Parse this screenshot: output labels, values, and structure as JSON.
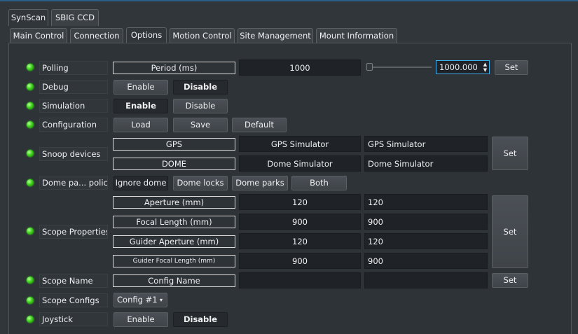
{
  "top_tabs": [
    "SynScan",
    "SBIG CCD"
  ],
  "sub_tabs": [
    "Main Control",
    "Connection",
    "Options",
    "Motion Control",
    "Site Management",
    "Mount Information"
  ],
  "polling": {
    "label": "Polling",
    "header": "Period (ms)",
    "value": "1000",
    "spin_value": "1000.000",
    "set": "Set"
  },
  "debug": {
    "label": "Debug",
    "enable": "Enable",
    "disable": "Disable"
  },
  "simulation": {
    "label": "Simulation",
    "enable": "Enable",
    "disable": "Disable"
  },
  "configuration": {
    "label": "Configuration",
    "load": "Load",
    "save": "Save",
    "default": "Default"
  },
  "snoop": {
    "label": "Snoop devices",
    "rows": [
      {
        "header": "GPS",
        "value": "GPS Simulator",
        "value2": "GPS Simulator"
      },
      {
        "header": "DOME",
        "value": "Dome Simulator",
        "value2": "Dome Simulator"
      }
    ],
    "set": "Set"
  },
  "dome_policy": {
    "label": "Dome pa... policy",
    "options": [
      "Ignore dome",
      "Dome locks",
      "Dome parks",
      "Both"
    ]
  },
  "scope_properties": {
    "label": "Scope Properties",
    "rows": [
      {
        "header": "Aperture (mm)",
        "value": "120",
        "value2": "120"
      },
      {
        "header": "Focal Length (mm)",
        "value": "900",
        "value2": "900"
      },
      {
        "header": "Guider Aperture (mm)",
        "value": "120",
        "value2": "120"
      },
      {
        "header": "Guider Focal Length (mm)",
        "value": "900",
        "value2": "900"
      }
    ],
    "set": "Set"
  },
  "scope_name": {
    "label": "Scope Name",
    "header": "Config Name",
    "value": "",
    "value2": "",
    "set": "Set"
  },
  "scope_configs": {
    "label": "Scope Configs",
    "selected": "Config #1"
  },
  "joystick": {
    "label": "Joystick",
    "enable": "Enable",
    "disable": "Disable"
  },
  "colors": {
    "led": "#3fd41a",
    "accent": "#3daee9",
    "background": "#31363b"
  }
}
